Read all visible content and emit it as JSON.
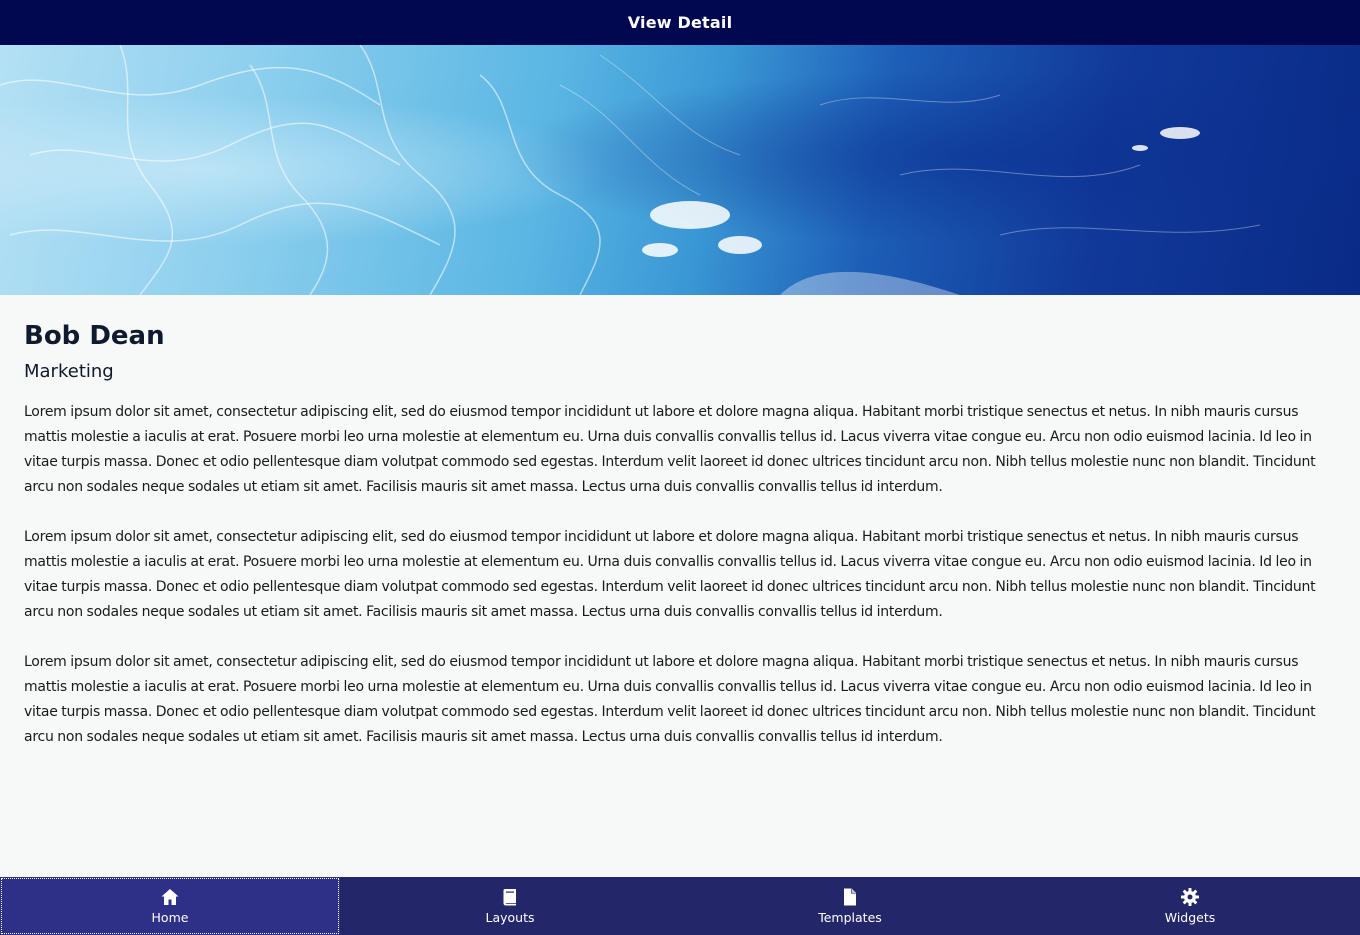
{
  "header": {
    "title": "View Detail"
  },
  "hero": {
    "image": "ocean-water-wave-image"
  },
  "profile": {
    "name": "Bob Dean",
    "department": "Marketing",
    "paragraphs": [
      "Lorem ipsum dolor sit amet, consectetur adipiscing elit, sed do eiusmod tempor incididunt ut labore et dolore magna aliqua. Habitant morbi tristique senectus et netus. In nibh mauris cursus mattis molestie a iaculis at erat. Posuere morbi leo urna molestie at elementum eu. Urna duis convallis convallis tellus id. Lacus viverra vitae congue eu. Arcu non odio euismod lacinia. Id leo in vitae turpis massa. Donec et odio pellentesque diam volutpat commodo sed egestas. Interdum velit laoreet id donec ultrices tincidunt arcu non. Nibh tellus molestie nunc non blandit. Tincidunt arcu non sodales neque sodales ut etiam sit amet. Facilisis mauris sit amet massa. Lectus urna duis convallis convallis tellus id interdum.",
      "Lorem ipsum dolor sit amet, consectetur adipiscing elit, sed do eiusmod tempor incididunt ut labore et dolore magna aliqua. Habitant morbi tristique senectus et netus. In nibh mauris cursus mattis molestie a iaculis at erat. Posuere morbi leo urna molestie at elementum eu. Urna duis convallis convallis tellus id. Lacus viverra vitae congue eu. Arcu non odio euismod lacinia. Id leo in vitae turpis massa. Donec et odio pellentesque diam volutpat commodo sed egestas. Interdum velit laoreet id donec ultrices tincidunt arcu non. Nibh tellus molestie nunc non blandit. Tincidunt arcu non sodales neque sodales ut etiam sit amet. Facilisis mauris sit amet massa. Lectus urna duis convallis convallis tellus id interdum.",
      "Lorem ipsum dolor sit amet, consectetur adipiscing elit, sed do eiusmod tempor incididunt ut labore et dolore magna aliqua. Habitant morbi tristique senectus et netus. In nibh mauris cursus mattis molestie a iaculis at erat. Posuere morbi leo urna molestie at elementum eu. Urna duis convallis convallis tellus id. Lacus viverra vitae congue eu. Arcu non odio euismod lacinia. Id leo in vitae turpis massa. Donec et odio pellentesque diam volutpat commodo sed egestas. Interdum velit laoreet id donec ultrices tincidunt arcu non. Nibh tellus molestie nunc non blandit. Tincidunt arcu non sodales neque sodales ut etiam sit amet. Facilisis mauris sit amet massa. Lectus urna duis convallis convallis tellus id interdum."
    ]
  },
  "bottom_nav": {
    "items": [
      {
        "label": "Home",
        "icon": "home-icon",
        "active": true
      },
      {
        "label": "Layouts",
        "icon": "book-icon",
        "active": false
      },
      {
        "label": "Templates",
        "icon": "file-icon",
        "active": false
      },
      {
        "label": "Widgets",
        "icon": "gear-icon",
        "active": false
      }
    ]
  },
  "colors": {
    "header_bg": "#020850",
    "nav_bg": "#24266a",
    "nav_active_bg": "#2e2f86",
    "page_bg": "#f7f8f8"
  }
}
